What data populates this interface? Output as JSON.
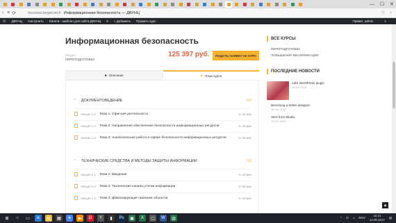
{
  "browser": {
    "domain": "mcrosss.beget.tech",
    "tab_title": "Информационная безопасность — ДВУНЦ",
    "window_controls": [
      "—",
      "☐",
      "✕"
    ]
  },
  "wp_admin_bar": {
    "site": "ДВУНЦ",
    "customize": "Настроить",
    "theme_note": "Eduma - шаблон для сайта ДВУНЦ",
    "comments": "0",
    "add": "+ Добавить",
    "edit_course": "Править курс",
    "greeting": "Привет, admin"
  },
  "course": {
    "title": "Информационная безопасность",
    "category_label": "Раздел",
    "category_value": "ПЕРЕПОДГОТОВКА",
    "price": "125 397 руб.",
    "apply_button": "ПОДАТЬ ЗАЯВКУ НА КУРС",
    "tabs": [
      {
        "label": "Описание",
        "icon": "bookmark-icon"
      },
      {
        "label": "План курса",
        "icon": "cube-icon"
      }
    ]
  },
  "curriculum": {
    "sections": [
      {
        "title": "ДОКУМЕНТОВЕДЕНИЕ",
        "count": "0/3",
        "lessons": [
          {
            "num": "Лекция 1.1",
            "title": "Тема 1: Офисная деятельность",
            "duration": "1ч 30 мин"
          },
          {
            "num": "Лекция 1.2",
            "title": "Тема 2: Направления обеспечения безопасности информационных ресурсов",
            "duration": "1ч 30 мин"
          },
          {
            "num": "Лекция 1.3",
            "title": "Тема 3: Аналитическая работа в сфере безопасности информационных ресурсов",
            "duration": "1ч 30 мин"
          }
        ]
      },
      {
        "title": "ТЕХНИЧЕСКИЕ СРЕДСТВА И МЕТОДЫ ЗАЩИТЫ ИНФОРМАЦИИ",
        "count": "0/3",
        "lessons": [
          {
            "num": "Лекция 2.1",
            "title": "Тема 1: Введение",
            "duration": "1ч 30 мин"
          },
          {
            "num": "Лекция 2.2",
            "title": "Тема 2: Технические каналы утечки информации",
            "duration": "1ч 30 мин"
          },
          {
            "num": "Лекция 2.3",
            "title": "Тема 3: Демаскирующие признаки объектов",
            "duration": "1ч 30 мин"
          }
        ]
      }
    ]
  },
  "sidebar": {
    "courses_title": "ВСЕ КУРСЫ",
    "categories": [
      "ПЕРЕПОДГОТОВКА",
      "ПОВЫШЕНИЕ КВАЛИФИКАЦИИ"
    ],
    "news_title": "ПОСЛЕДНИЕ НОВОСТИ",
    "posts": [
      {
        "title": "LMS WordPress plugin",
        "date": "16 Окт 2015"
      },
      {
        "title": "Becoming a better designer",
        "date": "16 Окт 2015"
      },
      {
        "title": "SEO from Media",
        "date": "16 Окт 2015"
      }
    ]
  },
  "taskbar": {
    "lang": "ENG",
    "time": "12:21",
    "date": "14.05.2017"
  },
  "colors": {
    "accent": "#f8b22f",
    "price": "#e8613c",
    "admin_bar": "#23282d",
    "taskbar": "#1f2329"
  }
}
